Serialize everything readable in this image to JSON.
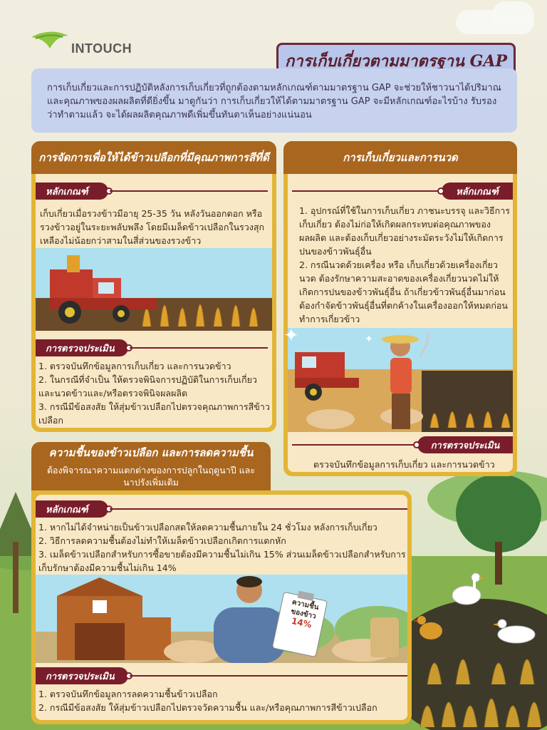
{
  "brand": {
    "name": "INTOUCH"
  },
  "title": "การเก็บเกี่ยวตามมาตรฐาน GAP",
  "intro": "การเก็บเกี่ยวและการปฏิบัติหลังการเก็บเกี่ยวที่ถูกต้องตามหลักเกณฑ์ตามมาตรฐาน GAP จะช่วยให้ชาวนาได้ปริมาณและคุณภาพของผลผลิตที่ดียิ่งขึ้น มาดูกันว่า การเก็บเกี่ยวให้ได้ตามมาตรฐาน GAP จะมีหลักเกณฑ์อะไรบ้าง รับรองว่าทำตามแล้ว จะได้ผลผลิตคุณภาพดีเพิ่มขึ้นทันตาเห็นอย่างแน่นอน",
  "section1": {
    "heading": "การจัดการเพื่อให้ได้ข้าวเปลือกที่มีคุณภาพการสีที่ดี",
    "criteria_label": "หลักเกณฑ์",
    "criteria": "เก็บเกี่ยวเมื่อรวงข้าวมีอายุ 25-35 วัน หลังวันออกดอก หรือรวงข้าวอยู่ในระยะพลับพลึง โดยมีเมล็ดข้าวเปลือกในรวงสุกเหลืองไม่น้อยกว่าสามในสี่ส่วนของรวงข้าว",
    "assess_label": "การตรวจประเมิน",
    "assess": [
      "1. ตรวจบันทึกข้อมูลการเก็บเกี่ยว และการนวดข้าว",
      "2. ในกรณีที่จำเป็น ให้ตรวจพินิจการปฏิบัติในการเก็บเกี่ยวและนวดข้าวและ/หรือตรวจพินิจผลผลิต",
      "3. กรณีมีข้อสงสัย ให้สุ่มข้าวเปลือกไปตรวจคุณภาพการสีข้าวเปลือก"
    ]
  },
  "section2": {
    "heading": "การเก็บเกี่ยวและการนวด",
    "criteria_label": "หลักเกณฑ์",
    "criteria": [
      "1. อุปกรณ์ที่ใช้ในการเก็บเกี่ยว ภาชนะบรรจุ และวิธีการเก็บเกี่ยว ต้องไม่ก่อให้เกิดผลกระทบต่อคุณภาพของผลผลิต และต้องเก็บเกี่ยวอย่างระมัดระวังไม่ให้เกิดการปนของข้าวพันธุ์อื่น",
      "2. กรณีนวดด้วยเครื่อง หรือ เก็บเกี่ยวด้วยเครื่องเกี่ยวนวด ต้องรักษาความสะอาดของเครื่องเกี่ยวนวดไม่ให้เกิดการปนของข้าวพันธุ์อื่น ถ้าเกี่ยวข้าวพันธุ์อื่นมาก่อนต้องกำจัดข้าวพันธุ์อื่นที่ตกค้างในเครื่องออกให้หมดก่อนทำการเกี่ยวข้าว"
    ],
    "assess_label": "การตรวจประเมิน",
    "assess": "ตรวจบันทึกข้อมูลการเก็บเกี่ยว และการนวดข้าว"
  },
  "section3": {
    "heading": "ความชื้นของข้าวเปลือก และการลดความชื้น",
    "subheading": "ต้องพิจารณาความแตกต่างของการปลูกในฤดูนาปี และนาปรังเพิ่มเติม",
    "criteria_label": "หลักเกณฑ์",
    "criteria": [
      "1. หากไม่ได้จำหน่ายเป็นข้าวเปลือกสดให้ลดความชื้นภายใน 24 ชั่วโมง หลังการเก็บเกี่ยว",
      "2. วิธีการลดความชื้นต้องไม่ทำให้เมล็ดข้าวเปลือกเกิดการแตกหัก",
      "3. เมล็ดข้าวเปลือกสำหรับการซื้อขายต้องมีความชื้นไม่เกิน 15% ส่วนเมล็ดข้าวเปลือกสำหรับการเก็บรักษาต้องมีความชื้นไม่เกิน 14%"
    ],
    "clipboard": [
      "ความชื้น",
      "ของข้าว",
      "14%"
    ],
    "assess_label": "การตรวจประเมิน",
    "assess": [
      "1. ตรวจบันทึกข้อมูลการลดความชื้นข้าวเปลือก",
      "2. กรณีมีข้อสงสัย ให้สุ่มข้าวเปลือกไปตรวจวัดความชื้น และ/หรือคุณภาพการสีข้าวเปลือก"
    ]
  },
  "colors": {
    "panel": "#e3b537",
    "header": "#a9661e",
    "tag": "#7a1d2a",
    "intro_bg": "#c7d3ee"
  }
}
